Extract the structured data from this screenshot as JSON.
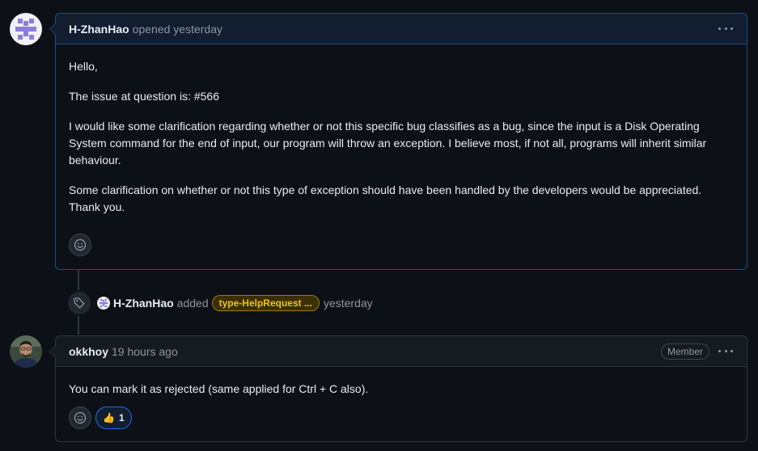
{
  "first_comment": {
    "author": "H-ZhanHao",
    "meta": "opened yesterday",
    "paragraphs": [
      "Hello,",
      "The issue at question is: #566",
      "I would like some clarification regarding whether or not this specific bug classifies as a bug, since the input is a Disk Operating System command for the end of input, our program will throw an exception. I believe most, if not all, programs will inherit similar behaviour.",
      "Some clarification on whether or not this type of exception should have been handled by the developers would be appreciated.",
      "Thank you."
    ],
    "avatar_icon": "identicon-avatar",
    "menu_icon": "kebab-horizontal-icon"
  },
  "label_event": {
    "actor": "H-ZhanHao",
    "action": "added",
    "label": "type-HelpRequest ...",
    "time": "yesterday",
    "icon": "tag-icon",
    "label_color": "#f0c21a"
  },
  "second_comment": {
    "author": "okkhoy",
    "meta": "19 hours ago",
    "badge": "Member",
    "body": "You can mark it as rejected (same applied for Ctrl + C also).",
    "reaction": {
      "emoji": "👍",
      "count": "1"
    },
    "avatar_icon": "user-photo-avatar"
  },
  "colors": {
    "background": "#0d1117",
    "author_border": "#1f4a85",
    "border": "#30363d",
    "accent": "#1f6feb"
  }
}
